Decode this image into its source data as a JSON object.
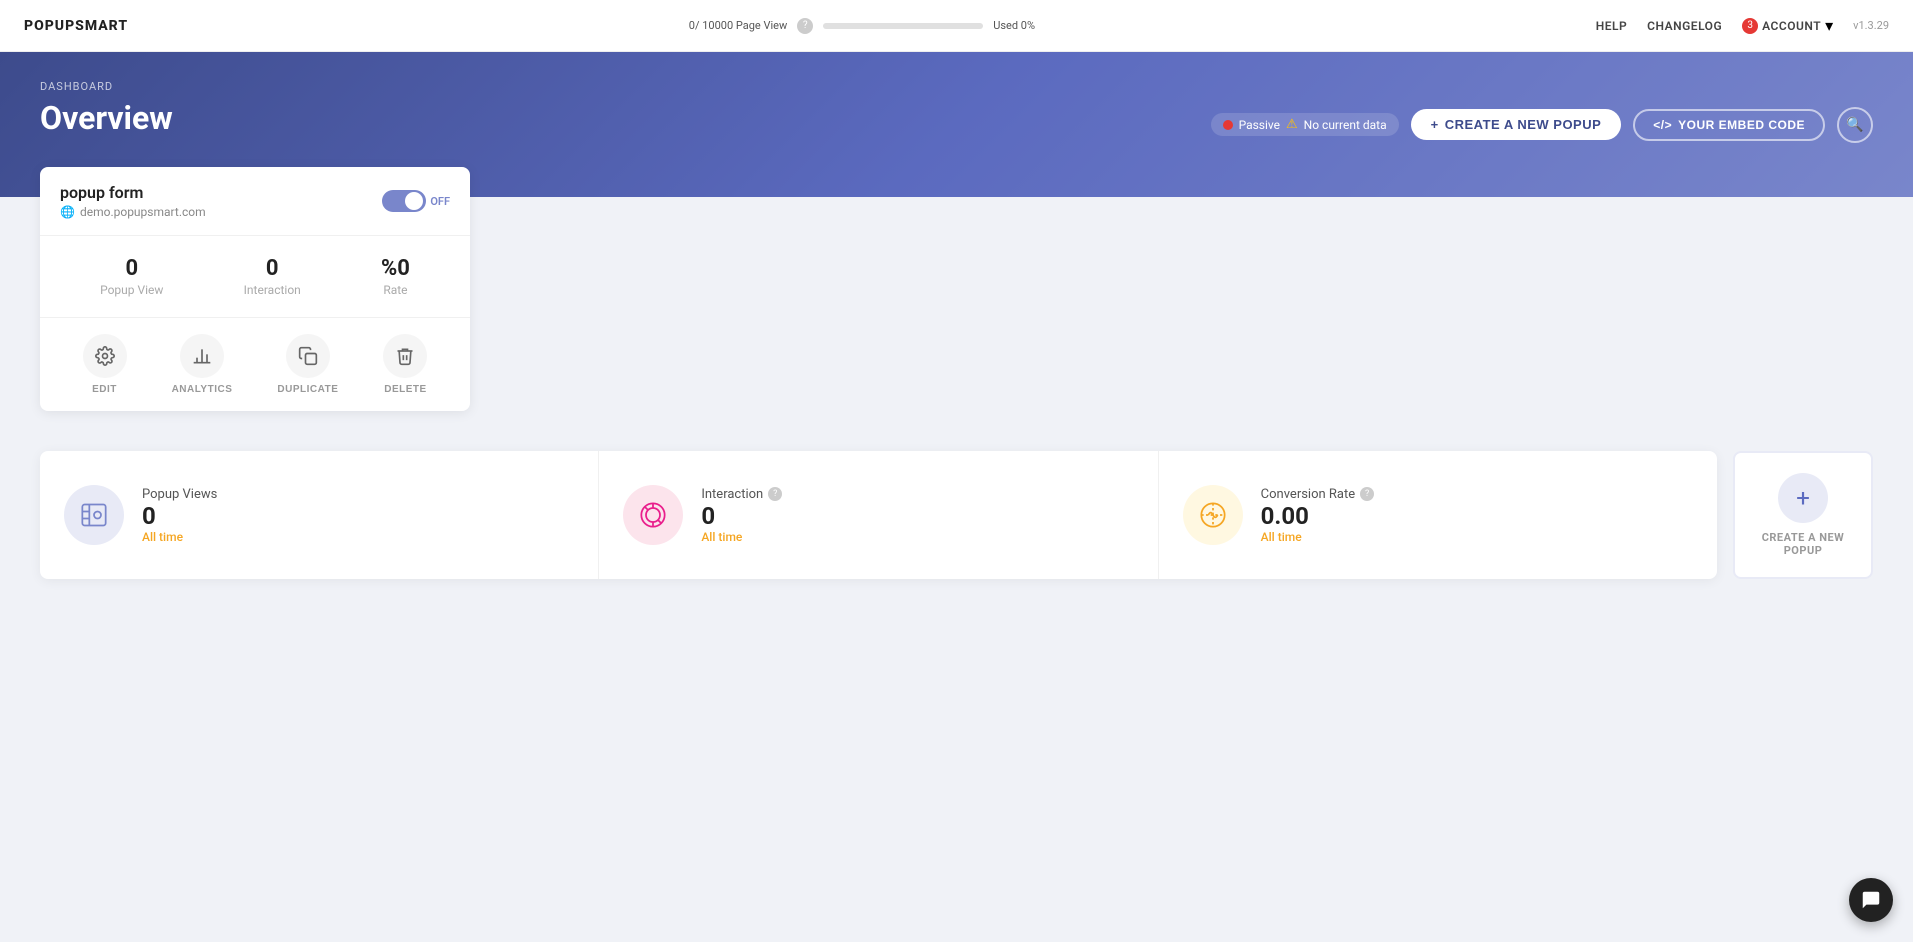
{
  "nav": {
    "logo": "POPUPSMART",
    "pageView": "0/ 10000 Page View",
    "used": "Used 0%",
    "progressWidth": "0%",
    "help": "HELP",
    "changelog": "CHANGELOG",
    "accountBadge": "3",
    "account": "ACCOUNT",
    "version": "v1.3.29"
  },
  "hero": {
    "breadcrumb": "DASHBOARD",
    "title": "Overview",
    "statusPassive": "Passive",
    "statusWarning": "⚠",
    "statusNoData": "No current data",
    "btnCreate": "CREATE A NEW POPUP",
    "btnEmbed": "YOUR EMBED CODE"
  },
  "popupCard": {
    "title": "popup form",
    "domain": "demo.popupsmart.com",
    "toggleLabel": "OFF",
    "stats": [
      {
        "value": "0",
        "label": "Popup View"
      },
      {
        "value": "0",
        "label": "Interaction"
      },
      {
        "value": "%0",
        "label": "Rate"
      }
    ],
    "actions": [
      {
        "label": "EDIT",
        "icon": "⚙"
      },
      {
        "label": "ANALYTICS",
        "icon": "📊"
      },
      {
        "label": "DUPLICATE",
        "icon": "⧉"
      },
      {
        "label": "DELETE",
        "icon": "🗑"
      }
    ]
  },
  "analytics": {
    "metrics": [
      {
        "title": "Popup Views",
        "value": "0",
        "sub": "All time",
        "iconColor": "views"
      },
      {
        "title": "Interaction",
        "value": "0",
        "sub": "All time",
        "iconColor": "interaction"
      },
      {
        "title": "Conversion Rate",
        "value": "0.00",
        "sub": "All time",
        "iconColor": "conversion"
      }
    ],
    "createNew": "CREATE A NEW POPUP"
  },
  "icons": {
    "question": "?",
    "plus": "+",
    "search": "🔍",
    "globe": "🌐",
    "chevronDown": "▾",
    "chat": "💬"
  }
}
